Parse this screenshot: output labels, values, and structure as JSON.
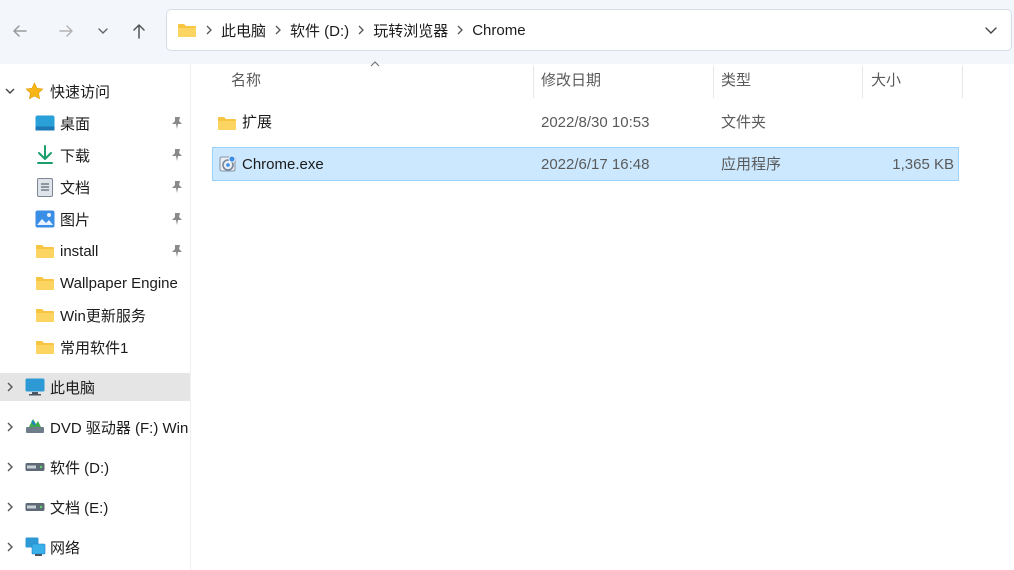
{
  "breadcrumb": [
    "此电脑",
    "软件 (D:)",
    "玩转浏览器",
    "Chrome"
  ],
  "sidebar": {
    "quick_access": {
      "label": "快速访问"
    },
    "pinned": [
      {
        "label": "桌面",
        "icon": "desktop-icon"
      },
      {
        "label": "下载",
        "icon": "download-icon"
      },
      {
        "label": "文档",
        "icon": "document-icon"
      },
      {
        "label": "图片",
        "icon": "pictures-icon"
      },
      {
        "label": "install",
        "icon": "folder-icon"
      }
    ],
    "recent": [
      {
        "label": "Wallpaper Engine",
        "icon": "folder-icon"
      },
      {
        "label": "Win更新服务",
        "icon": "folder-icon"
      },
      {
        "label": "常用软件1",
        "icon": "folder-icon"
      }
    ],
    "locations": [
      {
        "label": "此电脑",
        "icon": "this-pc-icon"
      },
      {
        "label": "DVD 驱动器 (F:) Win",
        "icon": "dvd-drive-icon"
      },
      {
        "label": "软件 (D:)",
        "icon": "drive-icon"
      },
      {
        "label": "文档 (E:)",
        "icon": "drive-icon"
      },
      {
        "label": "网络",
        "icon": "network-icon"
      }
    ]
  },
  "columns": {
    "name": "名称",
    "modified": "修改日期",
    "type": "类型",
    "size": "大小"
  },
  "files": [
    {
      "name": "扩展",
      "modified": "2022/8/30 10:53",
      "type": "文件夹",
      "size": "",
      "icon": "folder-icon"
    },
    {
      "name": "Chrome.exe",
      "modified": "2022/6/17 16:48",
      "type": "应用程序",
      "size": "1,365 KB",
      "icon": "app-exe-icon"
    }
  ],
  "colors": {
    "accent": "#0067c0",
    "selection": "#cce8ff",
    "selection_border": "#99d1ff",
    "folder": "#f8c542"
  }
}
